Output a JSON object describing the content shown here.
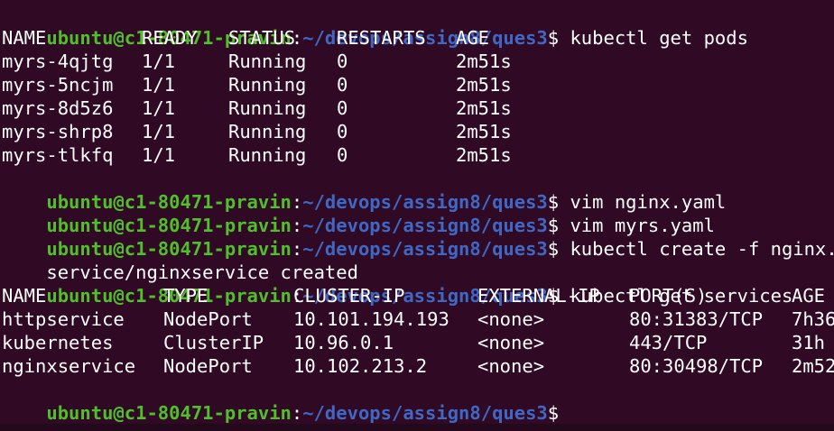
{
  "prompt": {
    "user_host": "ubuntu@c1-80471-pravin",
    "colon": ":",
    "path": "~/devops/assign8/ques3",
    "symbol": "$"
  },
  "commands": {
    "get_pods": "kubectl get pods",
    "vim_nginx": "vim nginx.yaml",
    "vim_myrs": "vim myrs.yaml",
    "create_nginx": "kubectl create -f nginx.yaml",
    "get_services": "kubectl get services"
  },
  "outputs": {
    "create_result": "service/nginxservice created"
  },
  "pods_table": {
    "headers": [
      "NAME",
      "READY",
      "STATUS",
      "RESTARTS",
      "AGE"
    ],
    "rows": [
      [
        "myrs-4qjtg",
        "1/1",
        "Running",
        "0",
        "2m51s"
      ],
      [
        "myrs-5ncjm",
        "1/1",
        "Running",
        "0",
        "2m51s"
      ],
      [
        "myrs-8d5z6",
        "1/1",
        "Running",
        "0",
        "2m51s"
      ],
      [
        "myrs-shrp8",
        "1/1",
        "Running",
        "0",
        "2m51s"
      ],
      [
        "myrs-tlkfq",
        "1/1",
        "Running",
        "0",
        "2m51s"
      ]
    ]
  },
  "services_table": {
    "headers": [
      "NAME",
      "TYPE",
      "CLUSTER-IP",
      "EXTERNAL-IP",
      "PORT(S)",
      "AGE"
    ],
    "rows": [
      [
        "httpservice",
        "NodePort",
        "10.101.194.193",
        "<none>",
        "80:31383/TCP",
        "7h36"
      ],
      [
        "kubernetes",
        "ClusterIP",
        "10.96.0.1",
        "<none>",
        "443/TCP",
        "31h"
      ],
      [
        "nginxservice",
        "NodePort",
        "10.102.213.2",
        "<none>",
        "80:30498/TCP",
        "2m52"
      ]
    ]
  },
  "colors": {
    "background": "#300a24",
    "user_host": "#4fbf2a",
    "path": "#3f67c4",
    "text": "#ffffff"
  }
}
